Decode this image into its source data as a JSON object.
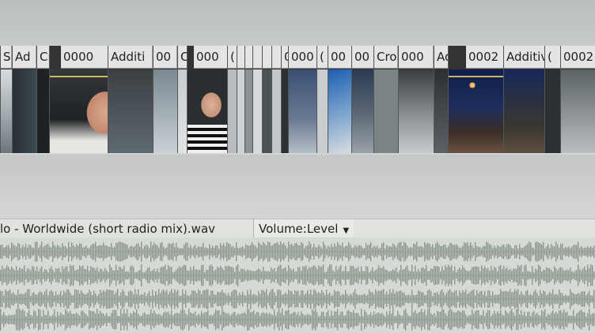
{
  "video_track": {
    "clips": [
      {
        "label": "S"
      },
      {
        "label": "Ad"
      },
      {
        "label": "Cr"
      },
      {
        "label": "0000"
      },
      {
        "label": "Additi"
      },
      {
        "label": "00"
      },
      {
        "label": "C"
      },
      {
        "label": "000"
      },
      {
        "label": "("
      },
      {
        "label": ""
      },
      {
        "label": ""
      },
      {
        "label": ""
      },
      {
        "label": ""
      },
      {
        "label": ""
      },
      {
        "label": "000"
      },
      {
        "label": "("
      },
      {
        "label": "00"
      },
      {
        "label": "00"
      },
      {
        "label": "Cro"
      },
      {
        "label": "000"
      },
      {
        "label": "Add"
      },
      {
        "label": "0002"
      },
      {
        "label": "Additive"
      },
      {
        "label": "("
      },
      {
        "label": "0002"
      }
    ]
  },
  "audio_track": {
    "file_name": "lo - Worldwide (short radio mix).wav",
    "envelope_label": "Volume:Level",
    "dropdown_icon": "caret-down-icon",
    "waveform_color": "#8c958c"
  }
}
